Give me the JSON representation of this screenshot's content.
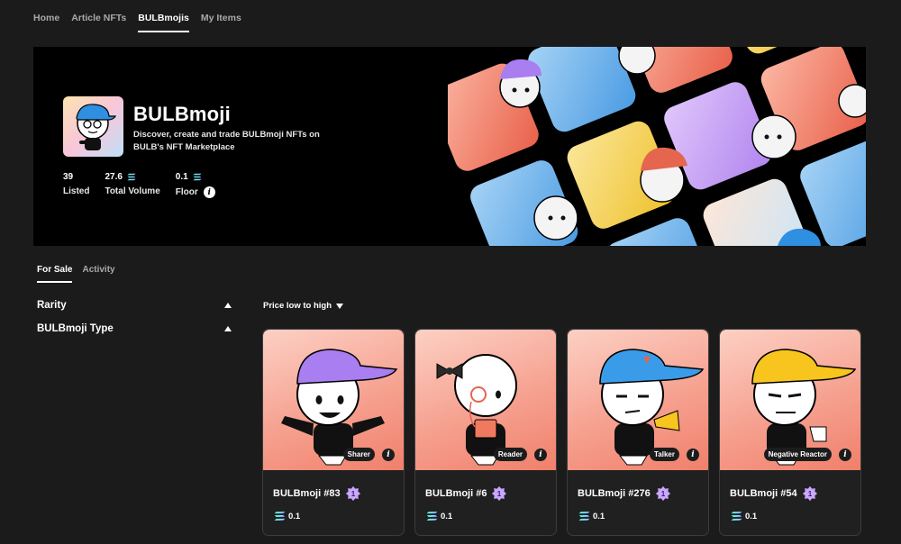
{
  "nav": {
    "items": [
      {
        "label": "Home",
        "active": false
      },
      {
        "label": "Article NFTs",
        "active": false
      },
      {
        "label": "BULBmojis",
        "active": true
      },
      {
        "label": "My Items",
        "active": false
      }
    ]
  },
  "collection": {
    "title": "BULBmoji",
    "description": "Discover, create and trade BULBmoji NFTs on BULB's NFT Marketplace",
    "stats": {
      "listed": {
        "value": "39",
        "label": "Listed"
      },
      "volume": {
        "value": "27.6",
        "label": "Total Volume"
      },
      "floor": {
        "value": "0.1",
        "label": "Floor"
      }
    }
  },
  "tabs": {
    "for_sale": "For Sale",
    "activity": "Activity"
  },
  "filters": {
    "rarity": "Rarity",
    "type": "BULBmoji Type"
  },
  "sort": {
    "label": "Price low to high"
  },
  "cards": [
    {
      "name": "BULBmoji #83",
      "type": "Sharer",
      "rank": "1",
      "price": "0.1",
      "cap_color": "#a97ef0"
    },
    {
      "name": "BULBmoji #6",
      "type": "Reader",
      "rank": "1",
      "price": "0.1",
      "cap_color": "none"
    },
    {
      "name": "BULBmoji #276",
      "type": "Talker",
      "rank": "1",
      "price": "0.1",
      "cap_color": "#3a9ce8"
    },
    {
      "name": "BULBmoji #54",
      "type": "Negative Reactor",
      "rank": "1",
      "price": "0.1",
      "cap_color": "#f7c51e"
    }
  ],
  "colors": {
    "background": "#1b1b1b",
    "card_art": "#f6a190",
    "solana_gradient": [
      "#9945ff",
      "#14f195"
    ],
    "rank_badge": "#c9a7ff"
  },
  "icons": {
    "solana": "solana-icon",
    "info": "info-icon",
    "rank": "rank-star-icon"
  }
}
